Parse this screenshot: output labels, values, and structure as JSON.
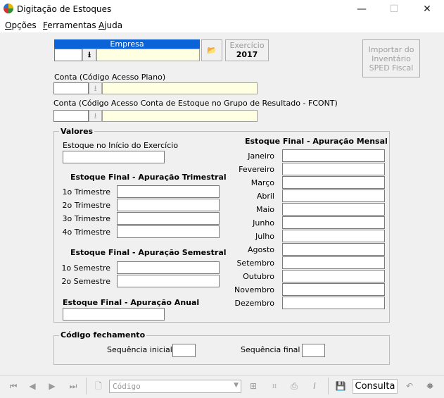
{
  "window": {
    "title": "Digitação de Estoques",
    "minimize": "—",
    "maximize": "☐",
    "close": "✕"
  },
  "menu": [
    {
      "first": "O",
      "rest": "pções"
    },
    {
      "first": "F",
      "rest": "erramentas"
    },
    {
      "first": "A",
      "rest": "juda"
    }
  ],
  "header": {
    "empresa_label": "Empresa",
    "empresa_value": "",
    "exercicio_label": "Exercício",
    "exercicio_value": "2017",
    "import_button": "Importar do Inventário SPED Fiscal"
  },
  "conta1": {
    "label": "Conta (Código Acesso Plano)",
    "code": "",
    "desc": ""
  },
  "conta2": {
    "label": "Conta (Código Acesso Conta de Estoque no Grupo de Resultado - FCONT)",
    "code": "",
    "desc": ""
  },
  "valores": {
    "legend": "Valores",
    "inicio_label": "Estoque no Início do Exercício",
    "trimestral_title": "Estoque Final - Apuração Trimestral",
    "trimestres": [
      "1o Trimestre",
      "2o Trimestre",
      "3o Trimestre",
      "4o Trimestre"
    ],
    "semestral_title": "Estoque Final - Apuração Semestral",
    "semestres": [
      "1o Semestre",
      "2o Semestre"
    ],
    "anual_title": "Estoque Final - Apuração Anual",
    "mensal_title": "Estoque Final - Apuração Mensal",
    "meses": [
      "Janeiro",
      "Fevereiro",
      "Março",
      "Abril",
      "Maio",
      "Junho",
      "Julho",
      "Agosto",
      "Setembro",
      "Outubro",
      "Novembro",
      "Dezembro"
    ]
  },
  "fechamento": {
    "legend": "Código fechamento",
    "inicial_label": "Sequência inicial",
    "final_label": "Sequência final"
  },
  "toolbar": {
    "codigo_placeholder": "Código",
    "mode": "Consulta"
  }
}
